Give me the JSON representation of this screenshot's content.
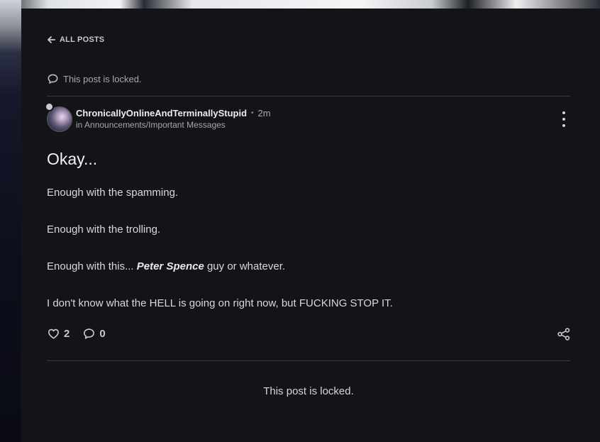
{
  "nav": {
    "back_label": "ALL POSTS"
  },
  "lock_notice_top": "This post is locked.",
  "post": {
    "author": "ChronicallyOnlineAndTerminallyStupid",
    "separator": "•",
    "time": "2m",
    "category_prefix": "in",
    "category": "Announcements/Important Messages",
    "title": "Okay...",
    "paragraphs": {
      "p1": "Enough with the spamming.",
      "p2": "Enough with the trolling.",
      "p3_before": "Enough with this... ",
      "p3_emphasis": "Peter Spence",
      "p3_after": " guy or whatever.",
      "p4": "I don't know what the HELL is going on right now, but FUCKING STOP IT."
    },
    "likes": "2",
    "comments": "0"
  },
  "lock_notice_bottom": "This post is locked.",
  "icons": {
    "back": "arrow-left-icon",
    "locked": "speech-bubble-icon",
    "menu": "more-vertical-icon",
    "like": "heart-icon",
    "comment": "comment-icon",
    "share": "share-icon"
  },
  "colors": {
    "panel": "#131417",
    "text": "#d8d9dc",
    "muted": "#a5a8ae"
  }
}
